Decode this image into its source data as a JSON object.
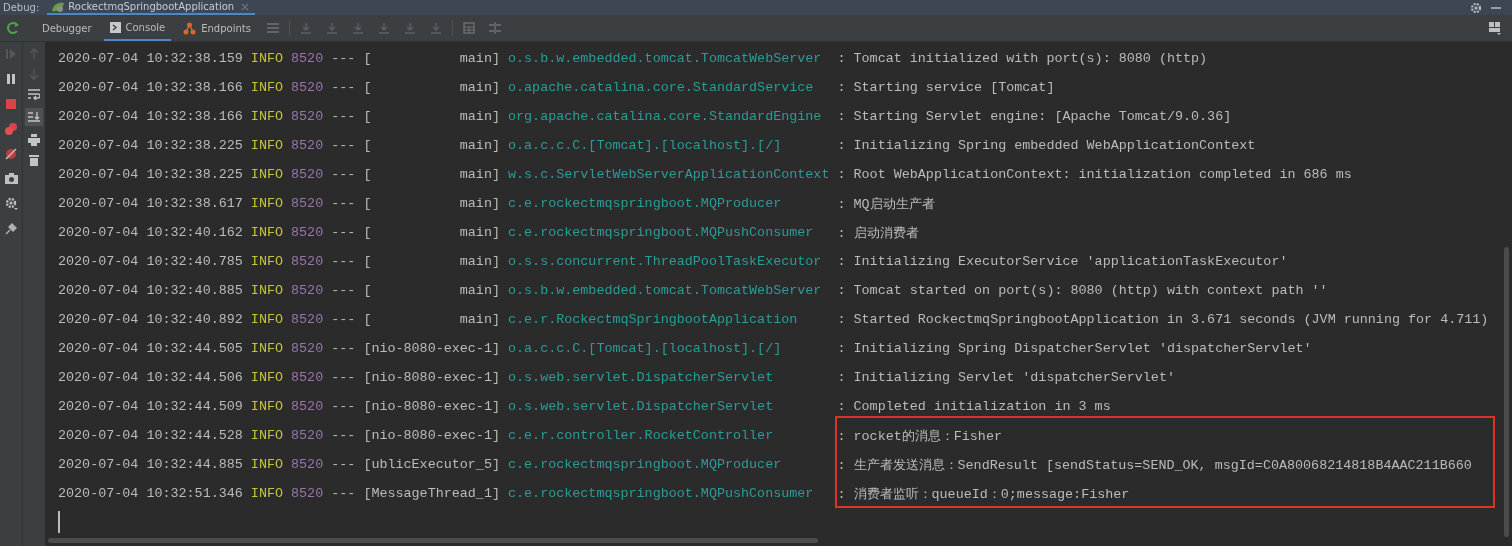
{
  "header": {
    "label": "Debug:",
    "session_tab": {
      "title": "RockectmqSpringbootApplication",
      "selected": true
    }
  },
  "tabs": [
    {
      "label": "Debugger",
      "selected": false,
      "kind": "plain"
    },
    {
      "label": "Console",
      "selected": true,
      "kind": "console"
    },
    {
      "label": "Endpoints",
      "selected": false,
      "kind": "endpoints"
    }
  ],
  "console": {
    "rows": [
      {
        "time": "2020-07-04 10:32:38.159",
        "level": "INFO",
        "pid": "8520",
        "sep": "---",
        "thread": "[           main]",
        "logger": "o.s.b.w.embedded.tomcat.TomcatWebServer",
        "message": ": Tomcat initialized with port(s): 8080 (http)"
      },
      {
        "time": "2020-07-04 10:32:38.166",
        "level": "INFO",
        "pid": "8520",
        "sep": "---",
        "thread": "[           main]",
        "logger": "o.apache.catalina.core.StandardService",
        "message": ": Starting service [Tomcat]"
      },
      {
        "time": "2020-07-04 10:32:38.166",
        "level": "INFO",
        "pid": "8520",
        "sep": "---",
        "thread": "[           main]",
        "logger": "org.apache.catalina.core.StandardEngine",
        "message": ": Starting Servlet engine: [Apache Tomcat/9.0.36]"
      },
      {
        "time": "2020-07-04 10:32:38.225",
        "level": "INFO",
        "pid": "8520",
        "sep": "---",
        "thread": "[           main]",
        "logger": "o.a.c.c.C.[Tomcat].[localhost].[/]",
        "message": ": Initializing Spring embedded WebApplicationContext"
      },
      {
        "time": "2020-07-04 10:32:38.225",
        "level": "INFO",
        "pid": "8520",
        "sep": "---",
        "thread": "[           main]",
        "logger": "w.s.c.ServletWebServerApplicationContext",
        "message": ": Root WebApplicationContext: initialization completed in 686 ms"
      },
      {
        "time": "2020-07-04 10:32:38.617",
        "level": "INFO",
        "pid": "8520",
        "sep": "---",
        "thread": "[           main]",
        "logger": "c.e.rockectmqspringboot.MQProducer",
        "message": ": MQ启动生产者"
      },
      {
        "time": "2020-07-04 10:32:40.162",
        "level": "INFO",
        "pid": "8520",
        "sep": "---",
        "thread": "[           main]",
        "logger": "c.e.rockectmqspringboot.MQPushConsumer",
        "message": ": 启动消费者"
      },
      {
        "time": "2020-07-04 10:32:40.785",
        "level": "INFO",
        "pid": "8520",
        "sep": "---",
        "thread": "[           main]",
        "logger": "o.s.s.concurrent.ThreadPoolTaskExecutor",
        "message": ": Initializing ExecutorService 'applicationTaskExecutor'"
      },
      {
        "time": "2020-07-04 10:32:40.885",
        "level": "INFO",
        "pid": "8520",
        "sep": "---",
        "thread": "[           main]",
        "logger": "o.s.b.w.embedded.tomcat.TomcatWebServer",
        "message": ": Tomcat started on port(s): 8080 (http) with context path ''"
      },
      {
        "time": "2020-07-04 10:32:40.892",
        "level": "INFO",
        "pid": "8520",
        "sep": "---",
        "thread": "[           main]",
        "logger": "c.e.r.RockectmqSpringbootApplication",
        "message": ": Started RockectmqSpringbootApplication in 3.671 seconds (JVM running for 4.711)"
      },
      {
        "time": "2020-07-04 10:32:44.505",
        "level": "INFO",
        "pid": "8520",
        "sep": "---",
        "thread": "[nio-8080-exec-1]",
        "logger": "o.a.c.c.C.[Tomcat].[localhost].[/]",
        "message": ": Initializing Spring DispatcherServlet 'dispatcherServlet'"
      },
      {
        "time": "2020-07-04 10:32:44.506",
        "level": "INFO",
        "pid": "8520",
        "sep": "---",
        "thread": "[nio-8080-exec-1]",
        "logger": "o.s.web.servlet.DispatcherServlet",
        "message": ": Initializing Servlet 'dispatcherServlet'"
      },
      {
        "time": "2020-07-04 10:32:44.509",
        "level": "INFO",
        "pid": "8520",
        "sep": "---",
        "thread": "[nio-8080-exec-1]",
        "logger": "o.s.web.servlet.DispatcherServlet",
        "message": ": Completed initialization in 3 ms"
      },
      {
        "time": "2020-07-04 10:32:44.528",
        "level": "INFO",
        "pid": "8520",
        "sep": "---",
        "thread": "[nio-8080-exec-1]",
        "logger": "c.e.r.controller.RocketController",
        "message": ": rocket的消息：Fisher"
      },
      {
        "time": "2020-07-04 10:32:44.885",
        "level": "INFO",
        "pid": "8520",
        "sep": "---",
        "thread": "[ublicExecutor_5]",
        "logger": "c.e.rockectmqspringboot.MQProducer",
        "message": ": 生产者发送消息：SendResult [sendStatus=SEND_OK, msgId=C0A80068214818B4AAC211B660"
      },
      {
        "time": "2020-07-04 10:32:51.346",
        "level": "INFO",
        "pid": "8520",
        "sep": "---",
        "thread": "[MessageThread_1]",
        "logger": "c.e.rockectmqspringboot.MQPushConsumer",
        "message": ": 消费者监听：queueId：0;message:Fisher"
      }
    ]
  }
}
